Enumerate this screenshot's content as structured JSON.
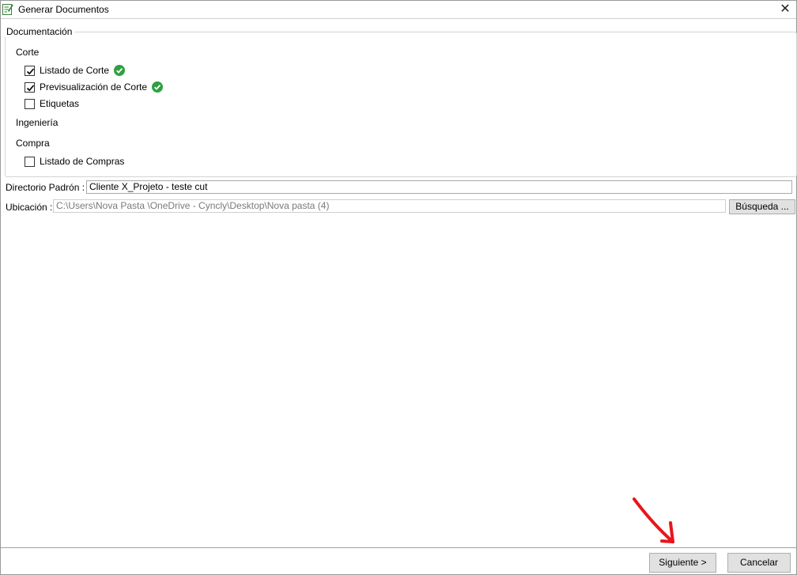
{
  "window": {
    "title": "Generar Documentos",
    "close_label": "✕"
  },
  "group": {
    "legend": "Documentación"
  },
  "sections": {
    "corte": {
      "label": "Corte",
      "items": [
        {
          "label": "Listado de Corte",
          "checked": true,
          "status": "ok"
        },
        {
          "label": "Previsualización de Corte",
          "checked": true,
          "status": "ok"
        },
        {
          "label": "Etiquetas",
          "checked": false
        }
      ]
    },
    "ingenieria": {
      "label": "Ingeniería"
    },
    "compra": {
      "label": "Compra",
      "items": [
        {
          "label": "Listado de Compras",
          "checked": false
        }
      ]
    }
  },
  "directorio": {
    "label": "Directorio Padrón :",
    "value": "Cliente X_Projeto - teste cut"
  },
  "ubicacion": {
    "label": "Ubicación :",
    "value": "C:\\Users\\Nova Pasta  \\OneDrive - Cyncly\\Desktop\\Nova pasta (4)",
    "button_label": "Búsqueda ..."
  },
  "footer": {
    "next_label": "Siguiente >",
    "cancel_label": "Cancelar"
  },
  "colors": {
    "ok_green": "#2ea043",
    "arrow_red": "#e8161b"
  }
}
